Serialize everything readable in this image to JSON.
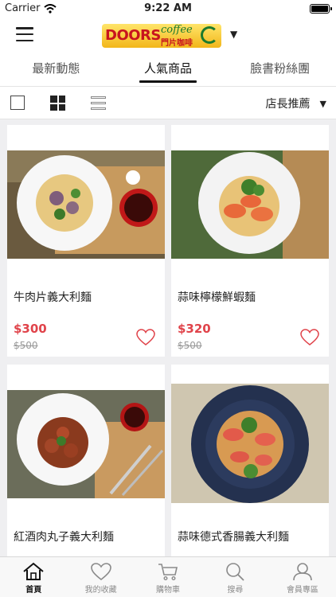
{
  "status": {
    "carrier": "Carrier",
    "time": "9:22 AM"
  },
  "header": {
    "logo_text": "DOORS",
    "logo_coffee": "coffee",
    "logo_chinese": "門片咖啡"
  },
  "tabs": [
    {
      "label": "最新動態",
      "active": false
    },
    {
      "label": "人氣商品",
      "active": true
    },
    {
      "label": "臉書粉絲團",
      "active": false
    }
  ],
  "toolbar": {
    "sort_label": "店長推薦"
  },
  "products": [
    {
      "name": "牛肉片義大利麵",
      "price": "$300",
      "original_price": "$500"
    },
    {
      "name": "蒜味檸檬鮮蝦麵",
      "price": "$320",
      "original_price": "$500"
    },
    {
      "name": "紅酒肉丸子義大利麵"
    },
    {
      "name": "蒜味德式香腸義大利麵"
    }
  ],
  "tabbar": [
    {
      "label": "首頁",
      "icon": "home-icon",
      "active": true
    },
    {
      "label": "我的收藏",
      "icon": "heart-icon",
      "active": false
    },
    {
      "label": "購物車",
      "icon": "cart-icon",
      "active": false
    },
    {
      "label": "搜尋",
      "icon": "search-icon",
      "active": false
    },
    {
      "label": "會員專區",
      "icon": "user-icon",
      "active": false
    }
  ],
  "colors": {
    "price": "#e0434a",
    "accent_active": "#111111",
    "logo_red": "#c8141e",
    "logo_green": "#1b7a2e"
  }
}
